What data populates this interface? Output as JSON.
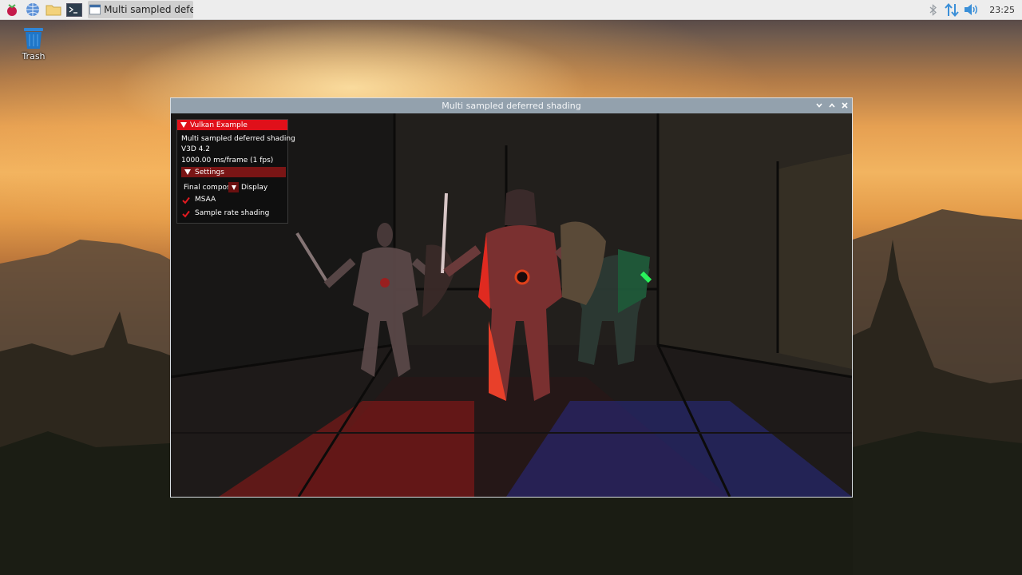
{
  "taskbar": {
    "launchers": [
      {
        "icon": "raspberry-menu-icon"
      },
      {
        "icon": "web-browser-icon"
      },
      {
        "icon": "file-manager-icon"
      },
      {
        "icon": "terminal-icon"
      }
    ],
    "task_button_label": "Multi sampled deferre...",
    "tray_icons": [
      "bluetooth-icon",
      "network-updown-icon",
      "volume-icon"
    ],
    "clock": "23:25"
  },
  "desktop": {
    "trash_label": "Trash"
  },
  "window": {
    "title": "Multi sampled deferred shading",
    "buttons": [
      "minimize",
      "maximize",
      "close"
    ]
  },
  "overlay": {
    "header": "Vulkan Example",
    "example_name": "Multi sampled deferred shading",
    "device": "V3D 4.2",
    "frame_time": "1000.00 ms/frame (1 fps)",
    "settings_header": "Settings",
    "combo_label": "Final compos",
    "combo_value": "Display",
    "checkboxes": [
      {
        "label": "MSAA",
        "checked": true
      },
      {
        "label": "Sample rate shading",
        "checked": true
      }
    ]
  },
  "colors": {
    "accent_red": "#e0101a",
    "settings_red": "#7a1515",
    "titlebar": "#93a1ad",
    "taskbar": "#ededed"
  }
}
